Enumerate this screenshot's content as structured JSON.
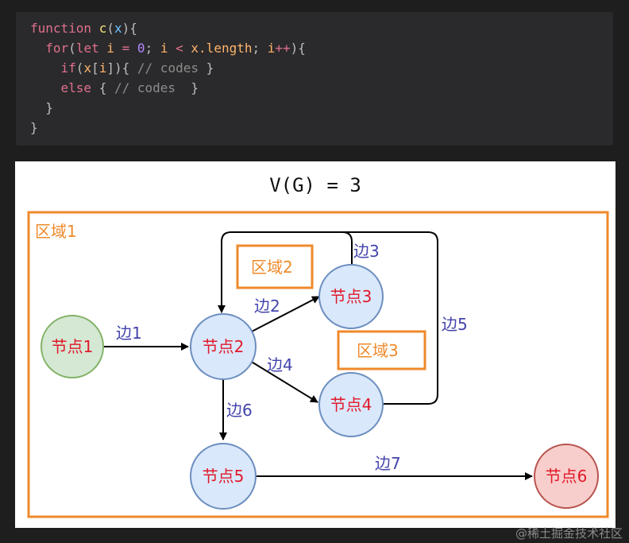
{
  "code": {
    "line1": {
      "kw": "function",
      "fn": "c",
      "p1": "(",
      "param": "x",
      "p2": "){"
    },
    "line2": {
      "kw1": "for",
      "p1": "(",
      "kw2": "let",
      "v1": "i",
      "op1": "=",
      "num": "0",
      "semi1": ";",
      "v2": "i",
      "op2": "<",
      "obj": "x",
      "prop": ".length",
      "semi2": ";",
      "v3": "i",
      "op3": "++",
      "p2": "){"
    },
    "line3": {
      "kw": "if",
      "p1": "(",
      "v1": "x",
      "b1": "[",
      "v2": "i",
      "b2": "])",
      "p2": "{",
      "cm": "// codes",
      "p3": "}"
    },
    "line4": {
      "kw": "else",
      "p1": "{",
      "cm": "// codes",
      "p2": "}"
    },
    "line5": "}",
    "line6": "}"
  },
  "diagram": {
    "formula": "V(G) = 3",
    "regions": {
      "r1": "区域1",
      "r2": "区域2",
      "r3": "区域3"
    },
    "nodes": {
      "n1": "节点1",
      "n2": "节点2",
      "n3": "节点3",
      "n4": "节点4",
      "n5": "节点5",
      "n6": "节点6"
    },
    "edges": {
      "e1": "边1",
      "e2": "边2",
      "e3": "边3",
      "e4": "边4",
      "e5": "边5",
      "e6": "边6",
      "e7": "边7"
    },
    "colors": {
      "region_border": "#ef8a2b",
      "node_default_fill": "#dae8fc",
      "node_default_stroke": "#6c8ebf",
      "node_start_fill": "#d5e8d4",
      "node_start_stroke": "#82b366",
      "node_end_fill": "#f8cecc",
      "node_end_stroke": "#b85450",
      "node_text": "#e0192a",
      "edge_text": "#4343ad"
    }
  },
  "watermark": "@稀土掘金技术社区"
}
